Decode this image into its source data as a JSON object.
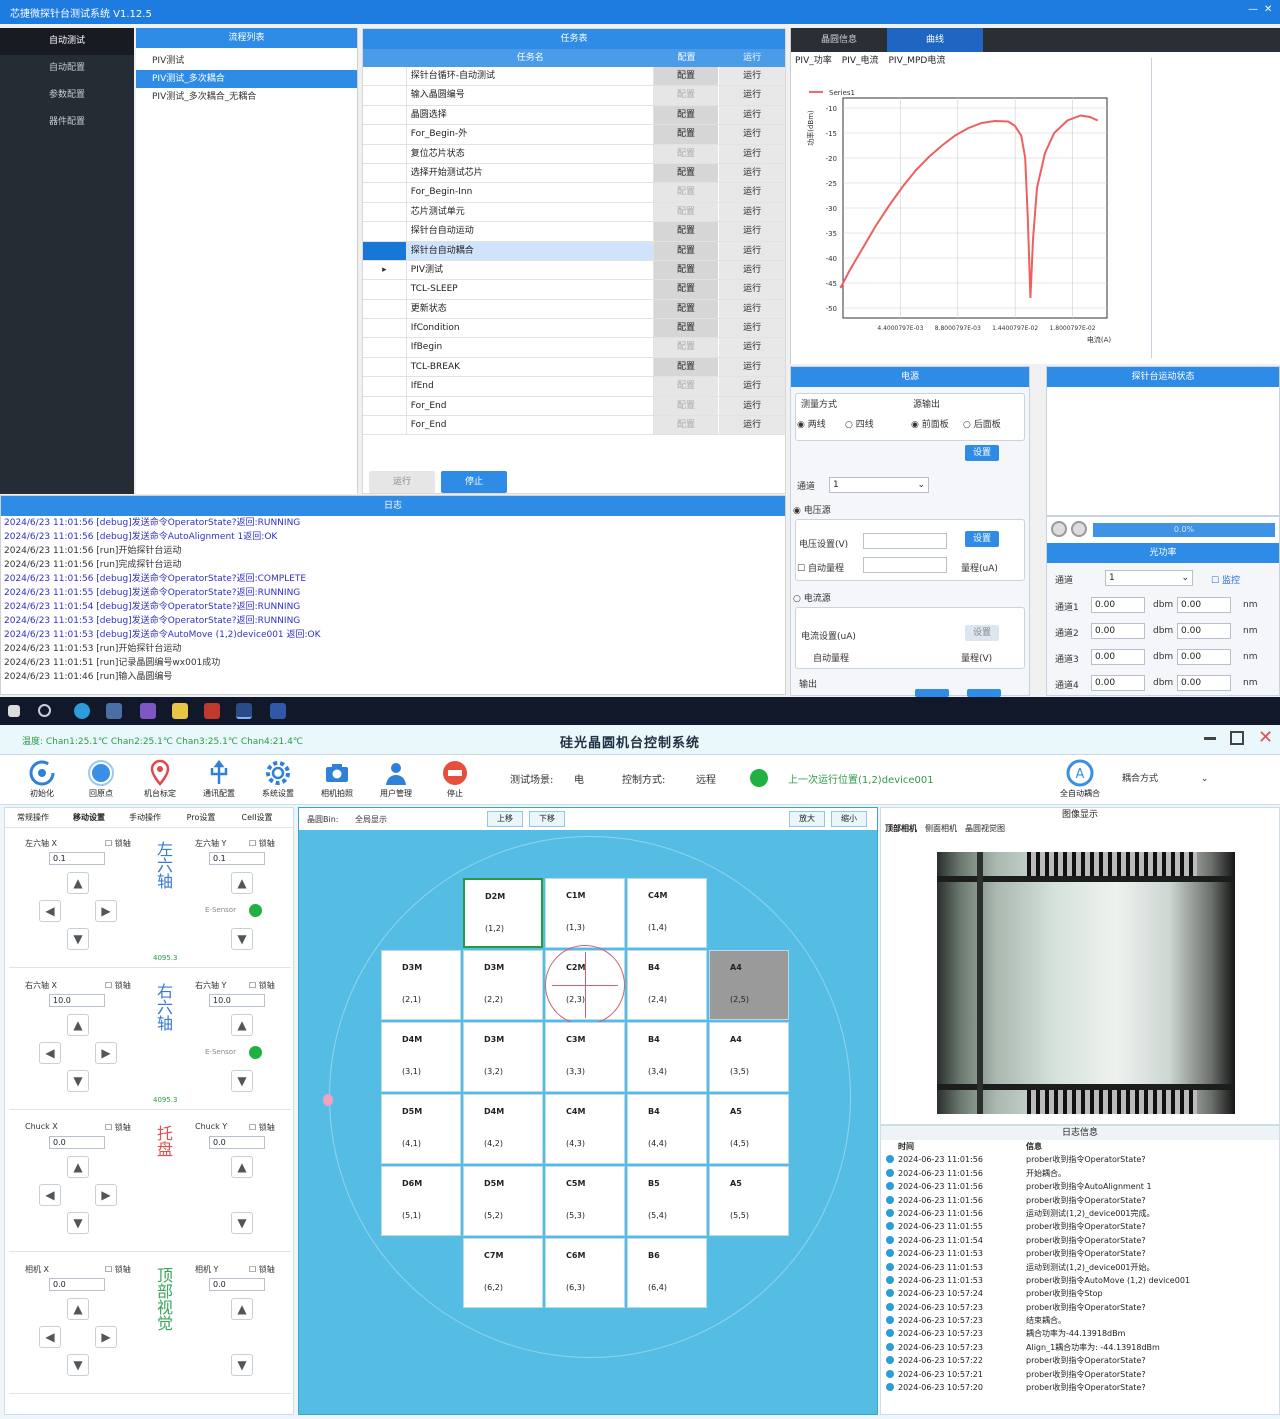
{
  "window1": {
    "title": "芯捷微探针台测试系统 V1.12.5",
    "min": "—",
    "close": "✕",
    "nav": [
      "自动测试",
      "自动配置",
      "参数配置",
      "器件配置"
    ],
    "flows_title": "流程列表",
    "flows": [
      "PIV测试",
      "PIV测试_多次耦合",
      "PIV测试_多次耦合_无耦合"
    ],
    "tasks_title": "任务表",
    "table_headers": [
      "任务名",
      "配置",
      "运行"
    ],
    "tasks": [
      {
        "name": "探针台循环-自动测试",
        "config": "配置",
        "run": "运行",
        "cfg_on": true
      },
      {
        "name": "输入晶圆编号",
        "config": "配置",
        "run": "运行",
        "cfg_on": false
      },
      {
        "name": "晶圆选择",
        "config": "配置",
        "run": "运行",
        "cfg_on": true
      },
      {
        "name": "For_Begin-外",
        "config": "配置",
        "run": "运行",
        "cfg_on": true
      },
      {
        "name": "复位芯片状态",
        "config": "配置",
        "run": "运行",
        "cfg_on": false
      },
      {
        "name": "选择开始测试芯片",
        "config": "配置",
        "run": "运行",
        "cfg_on": true
      },
      {
        "name": "For_Begin-Inn",
        "config": "配置",
        "run": "运行",
        "cfg_on": false
      },
      {
        "name": "芯片测试单元",
        "config": "配置",
        "run": "运行",
        "cfg_on": false
      },
      {
        "name": "探针台自动运动",
        "config": "配置",
        "run": "运行",
        "cfg_on": true
      },
      {
        "name": "探针台自动耦合",
        "config": "配置",
        "run": "运行",
        "cfg_on": true,
        "selected": true
      },
      {
        "name": "PIV测试",
        "config": "配置",
        "run": "运行",
        "cfg_on": true,
        "marker": "▸"
      },
      {
        "name": "TCL-SLEEP",
        "config": "配置",
        "run": "运行",
        "cfg_on": true
      },
      {
        "name": "更新状态",
        "config": "配置",
        "run": "运行",
        "cfg_on": true
      },
      {
        "name": "IfCondition",
        "config": "配置",
        "run": "运行",
        "cfg_on": true
      },
      {
        "name": "IfBegin",
        "config": "配置",
        "run": "运行",
        "cfg_on": false
      },
      {
        "name": "TCL-BREAK",
        "config": "配置",
        "run": "运行",
        "cfg_on": true
      },
      {
        "name": "IfEnd",
        "config": "配置",
        "run": "运行",
        "cfg_on": false
      },
      {
        "name": "For_End",
        "config": "配置",
        "run": "运行",
        "cfg_on": false
      },
      {
        "name": "For_End",
        "config": "配置",
        "run": "运行",
        "cfg_on": false
      }
    ],
    "btn_run": "运行",
    "btn_stop": "停止",
    "log_title": "日志",
    "log_lines": [
      {
        "text": "2024/6/23 11:01:56 [debug]发送命令OperatorState?返回:RUNNING",
        "blue": true
      },
      {
        "text": "2024/6/23 11:01:56 [debug]发送命令AutoAlignment 1返回:OK",
        "blue": true
      },
      {
        "text": "2024/6/23 11:01:56 [run]开始探针台运动",
        "blue": false
      },
      {
        "text": "2024/6/23 11:01:56 [run]完成探针台运动",
        "blue": false
      },
      {
        "text": "2024/6/23 11:01:56 [debug]发送命令OperatorState?返回:COMPLETE",
        "blue": true
      },
      {
        "text": "2024/6/23 11:01:55 [debug]发送命令OperatorState?返回:RUNNING",
        "blue": true
      },
      {
        "text": "2024/6/23 11:01:54 [debug]发送命令OperatorState?返回:RUNNING",
        "blue": true
      },
      {
        "text": "2024/6/23 11:01:53 [debug]发送命令OperatorState?返回:RUNNING",
        "blue": true
      },
      {
        "text": "2024/6/23 11:01:53 [debug]发送命令AutoMove (1,2)device001 返回:OK",
        "blue": true
      },
      {
        "text": "2024/6/23 11:01:53 [run]开始探针台运动",
        "blue": false
      },
      {
        "text": "2024/6/23 11:01:51 [run]记录晶圆编号wx001成功",
        "blue": false
      },
      {
        "text": "2024/6/23 11:01:46 [run]输入晶圆编号",
        "blue": false
      }
    ],
    "chart_tabs": [
      "晶圆信息",
      "曲线"
    ],
    "chart_subtabs": [
      "PIV_功率",
      "PIV_电流",
      "PIV_MPD电流"
    ],
    "power_title": "电源",
    "power_mode_label": "测量方式",
    "power_mode_opts": [
      "两线",
      "四线"
    ],
    "power_out_label": "源输出",
    "power_out_opts": [
      "前面板",
      "后面板"
    ],
    "set_btn": "设置",
    "channel_label": "通道",
    "channel_val": "1",
    "voltage_src": "电压源",
    "voltage_set": "电压设置(V)",
    "auto_range": "自动量程",
    "range_label": "量程(uA)",
    "current_src": "电流源",
    "current_set": "电流设置(uA)",
    "auto_range2": "自动量程",
    "range_label2": "量程(V)",
    "output_label": "输出",
    "status_title": "探针台运动状态",
    "progress": "0.0%",
    "light_title": "光功率",
    "light_ch_label": "通道",
    "light_ch_val": "1",
    "light_check": "监控",
    "light_rows": [
      {
        "k": "通道1",
        "v": "0.00",
        "u": "dbm",
        "v2": "0.00",
        "u2": "nm"
      },
      {
        "k": "通道2",
        "v": "0.00",
        "u": "dbm",
        "v2": "0.00",
        "u2": "nm"
      },
      {
        "k": "通道3",
        "v": "0.00",
        "u": "dbm",
        "v2": "0.00",
        "u2": "nm"
      },
      {
        "k": "通道4",
        "v": "0.00",
        "u": "dbm",
        "v2": "0.00",
        "u2": "nm"
      }
    ]
  },
  "chart_data": {
    "type": "line",
    "title": "",
    "xlabel": "电流(A)",
    "ylabel": "功率(dBm)",
    "legend": "Series1",
    "legend_position": "top-left",
    "x_ticks": [
      "4.4000797E-03",
      "8.8000797E-03",
      "1.4400797E-02",
      "1.8000797E-02"
    ],
    "y_ticks": [
      "-10",
      "-15",
      "-20",
      "-25",
      "-30",
      "-35",
      "-40",
      "-45",
      "-50"
    ],
    "ylim": [
      -52,
      -8
    ],
    "xlim": [
      0.0005,
      0.0205
    ],
    "x": [
      0.0003,
      0.001,
      0.002,
      0.003,
      0.004,
      0.005,
      0.006,
      0.007,
      0.008,
      0.009,
      0.01,
      0.011,
      0.012,
      0.013,
      0.0135,
      0.014,
      0.0143,
      0.0145,
      0.0147,
      0.0149,
      0.0152,
      0.0158,
      0.0165,
      0.0175,
      0.0185,
      0.0192,
      0.0198
    ],
    "y": [
      -46,
      -42.5,
      -38,
      -33.5,
      -29.5,
      -25.8,
      -22.5,
      -19.8,
      -17.5,
      -15.5,
      -14,
      -13,
      -12.6,
      -12.7,
      -13.5,
      -15.5,
      -20,
      -32,
      -48,
      -36,
      -26,
      -19,
      -15,
      -12.5,
      -11.5,
      -11.8,
      -12.5
    ],
    "grid": true
  },
  "window2": {
    "status_left": "温度: Chan1:25.1℃ Chan2:25.1℃ Chan3:25.1℃ Chan4:21.4℃",
    "title": "硅光晶圆机台控制系统",
    "toolbar": [
      {
        "label": "初始化",
        "icon": "refresh-icon"
      },
      {
        "label": "回原点",
        "icon": "origin-icon"
      },
      {
        "label": "机台标定",
        "icon": "location-icon"
      },
      {
        "label": "通讯配置",
        "icon": "usb-icon"
      },
      {
        "label": "系统设置",
        "icon": "gear-icon"
      },
      {
        "label": "相机拍照",
        "icon": "camera-icon"
      },
      {
        "label": "用户管理",
        "icon": "user-icon"
      },
      {
        "label": "停止",
        "icon": "stop-icon"
      }
    ],
    "scene_label": "测试场景:",
    "scene_val": "电",
    "ctrl_label": "控制方式:",
    "ctrl_val": "远程",
    "last_pos": "上一次运行位置(1,2)device001",
    "auto_btn": "全自动耦合",
    "auto_sel": "耦合方式",
    "axis_tabs": [
      "常规操作",
      "移动设置",
      "手动操作",
      "Pro设置",
      "Cell设置"
    ],
    "axis_groups": [
      {
        "name": "左六轴",
        "color": "#3a79d8",
        "left": "左六轴 X",
        "right": "左六轴 Y",
        "lock": "锁轴",
        "step": "0.1",
        "sensor": "E-Sensor",
        "led": true,
        "read": "4095.3"
      },
      {
        "name": "右六轴",
        "color": "#3a79d8",
        "left": "右六轴 X",
        "right": "右六轴 Y",
        "lock": "锁轴",
        "step": "10.0",
        "sensor": "E-Sensor",
        "led": true,
        "read": "4095.3"
      },
      {
        "name": "托盘",
        "color": "#d9534f",
        "left": "Chuck X",
        "right": "Chuck Y",
        "lock": "锁轴",
        "step": "0.0",
        "sensor": "",
        "led": false,
        "read": ""
      },
      {
        "name": "顶部视觉",
        "color": "#3aa55a",
        "left": "相机 X",
        "right": "相机 Y",
        "lock": "锁轴",
        "step": "0.0",
        "sensor": "",
        "led": false,
        "read": ""
      }
    ],
    "wafer_toolbar": {
      "label": "晶圆Bin:",
      "bin": "全局显示",
      "b1": "上移",
      "b2": "下移",
      "b3": "放大",
      "b4": "缩小"
    },
    "cam_title": "图像显示",
    "cam_tabs": [
      "顶部相机",
      "侧面相机",
      "晶圆视觉图"
    ],
    "log_title": "日志信息",
    "log_headers": [
      "时间",
      "信息"
    ],
    "logs": [
      {
        "t": "2024-06-23 11:01:56",
        "m": "prober收到指令OperatorState?"
      },
      {
        "t": "2024-06-23 11:01:56",
        "m": "开始耦合。"
      },
      {
        "t": "2024-06-23 11:01:56",
        "m": "prober收到指令AutoAlignment 1"
      },
      {
        "t": "2024-06-23 11:01:56",
        "m": "prober收到指令OperatorState?"
      },
      {
        "t": "2024-06-23 11:01:56",
        "m": "运动到测试(1,2)_device001完成。"
      },
      {
        "t": "2024-06-23 11:01:55",
        "m": "prober收到指令OperatorState?"
      },
      {
        "t": "2024-06-23 11:01:54",
        "m": "prober收到指令OperatorState?"
      },
      {
        "t": "2024-06-23 11:01:53",
        "m": "prober收到指令OperatorState?"
      },
      {
        "t": "2024-06-23 11:01:53",
        "m": "运动到测试(1,2)_device001开始。"
      },
      {
        "t": "2024-06-23 11:01:53",
        "m": "prober收到指令AutoMove (1,2) device001"
      },
      {
        "t": "2024-06-23 10:57:24",
        "m": "prober收到指令Stop"
      },
      {
        "t": "2024-06-23 10:57:23",
        "m": "prober收到指令OperatorState?"
      },
      {
        "t": "2024-06-23 10:57:23",
        "m": "结束耦合。"
      },
      {
        "t": "2024-06-23 10:57:23",
        "m": "耦合功率为-44.13918dBm"
      },
      {
        "t": "2024-06-23 10:57:23",
        "m": "Align_1耦合功率为: -44.13918dBm"
      },
      {
        "t": "2024-06-23 10:57:22",
        "m": "prober收到指令OperatorState?"
      },
      {
        "t": "2024-06-23 10:57:21",
        "m": "prober收到指令OperatorState?"
      },
      {
        "t": "2024-06-23 10:57:20",
        "m": "prober收到指令OperatorState?"
      }
    ],
    "dies": [
      {
        "c": 2,
        "r": 0,
        "n": "D2M",
        "xy": "(1,2)",
        "state": "active"
      },
      {
        "c": 3,
        "r": 0,
        "n": "C1M",
        "xy": "(1,3)",
        "state": ""
      },
      {
        "c": 4,
        "r": 0,
        "n": "C4M",
        "xy": "(1,4)",
        "state": ""
      },
      {
        "c": 1,
        "r": 1,
        "n": "D3M",
        "xy": "(2,1)",
        "state": ""
      },
      {
        "c": 2,
        "r": 1,
        "n": "D3M",
        "xy": "(2,2)",
        "state": ""
      },
      {
        "c": 3,
        "r": 1,
        "n": "C2M",
        "xy": "(2,3)",
        "state": "target"
      },
      {
        "c": 4,
        "r": 1,
        "n": "B4",
        "xy": "(2,4)",
        "state": ""
      },
      {
        "c": 5,
        "r": 1,
        "n": "A4",
        "xy": "(2,5)",
        "state": "grey"
      },
      {
        "c": 1,
        "r": 2,
        "n": "D4M",
        "xy": "(3,1)",
        "state": ""
      },
      {
        "c": 2,
        "r": 2,
        "n": "D3M",
        "xy": "(3,2)",
        "state": ""
      },
      {
        "c": 3,
        "r": 2,
        "n": "C3M",
        "xy": "(3,3)",
        "state": ""
      },
      {
        "c": 4,
        "r": 2,
        "n": "B4",
        "xy": "(3,4)",
        "state": ""
      },
      {
        "c": 5,
        "r": 2,
        "n": "A4",
        "xy": "(3,5)",
        "state": ""
      },
      {
        "c": 1,
        "r": 3,
        "n": "D5M",
        "xy": "(4,1)",
        "state": ""
      },
      {
        "c": 2,
        "r": 3,
        "n": "D4M",
        "xy": "(4,2)",
        "state": ""
      },
      {
        "c": 3,
        "r": 3,
        "n": "C4M",
        "xy": "(4,3)",
        "state": ""
      },
      {
        "c": 4,
        "r": 3,
        "n": "B4",
        "xy": "(4,4)",
        "state": ""
      },
      {
        "c": 5,
        "r": 3,
        "n": "A5",
        "xy": "(4,5)",
        "state": ""
      },
      {
        "c": 1,
        "r": 4,
        "n": "D6M",
        "xy": "(5,1)",
        "state": ""
      },
      {
        "c": 2,
        "r": 4,
        "n": "D5M",
        "xy": "(5,2)",
        "state": ""
      },
      {
        "c": 3,
        "r": 4,
        "n": "C5M",
        "xy": "(5,3)",
        "state": ""
      },
      {
        "c": 4,
        "r": 4,
        "n": "B5",
        "xy": "(5,4)",
        "state": ""
      },
      {
        "c": 5,
        "r": 4,
        "n": "A5",
        "xy": "(5,5)",
        "state": ""
      },
      {
        "c": 2,
        "r": 5,
        "n": "C7M",
        "xy": "(6,2)",
        "state": ""
      },
      {
        "c": 3,
        "r": 5,
        "n": "C6M",
        "xy": "(6,3)",
        "state": ""
      },
      {
        "c": 4,
        "r": 5,
        "n": "B6",
        "xy": "(6,4)",
        "state": ""
      }
    ]
  }
}
